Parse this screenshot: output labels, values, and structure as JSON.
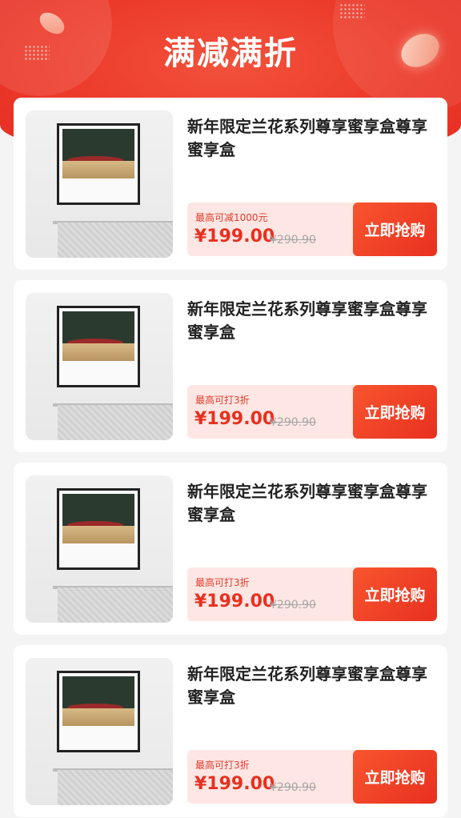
{
  "banner": {
    "title": "满减满折"
  },
  "colors": {
    "accent": "#e8301f",
    "banner": "#ec3a2a",
    "price_bg": "#fde6e3"
  },
  "products": [
    {
      "title": "新年限定兰花系列尊享蜜享盒尊享蜜享盒",
      "promo": "最高可减1000元",
      "price": "¥199.00",
      "original_price": "¥290.90",
      "button": "立即抢购"
    },
    {
      "title": "新年限定兰花系列尊享蜜享盒尊享蜜享盒",
      "promo": "最高可打3折",
      "price": "¥199.00",
      "original_price": "¥290.90",
      "button": "立即抢购"
    },
    {
      "title": "新年限定兰花系列尊享蜜享盒尊享蜜享盒",
      "promo": "最高可打3折",
      "price": "¥199.00",
      "original_price": "¥290.90",
      "button": "立即抢购"
    },
    {
      "title": "新年限定兰花系列尊享蜜享盒尊享蜜享盒",
      "promo": "最高可打3折",
      "price": "¥199.00",
      "original_price": "¥290.90",
      "button": "立即抢购"
    }
  ]
}
